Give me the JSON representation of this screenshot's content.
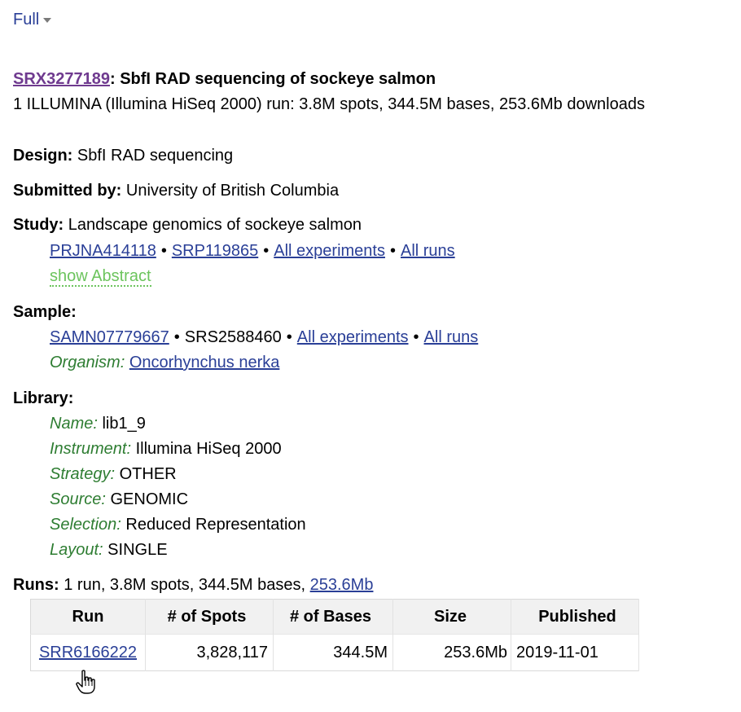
{
  "view_selector": {
    "value": "Full"
  },
  "experiment": {
    "accession": "SRX3277189",
    "title": "SbfI RAD sequencing of sockeye salmon",
    "summary": "1 ILLUMINA (Illumina HiSeq 2000) run: 3.8M spots, 344.5M bases, 253.6Mb downloads"
  },
  "design": {
    "label": "Design:",
    "value": "SbfI RAD sequencing"
  },
  "submitted_by": {
    "label": "Submitted by:",
    "value": "University of British Columbia"
  },
  "study": {
    "label": "Study:",
    "value": "Landscape genomics of sockeye salmon",
    "bioproject": "PRJNA414118",
    "srp": "SRP119865",
    "all_experiments": "All experiments",
    "all_runs": "All runs",
    "show_abstract": "show Abstract",
    "bullet": "•"
  },
  "sample": {
    "label": "Sample:",
    "biosample": "SAMN07779667",
    "srs": "SRS2588460",
    "all_experiments": "All experiments",
    "all_runs": "All runs",
    "organism_label": "Organism:",
    "organism": "Oncorhynchus nerka",
    "bullet": "•"
  },
  "library": {
    "label": "Library:",
    "fields": [
      {
        "label": "Name:",
        "value": "lib1_9"
      },
      {
        "label": "Instrument:",
        "value": "Illumina HiSeq 2000"
      },
      {
        "label": "Strategy:",
        "value": "OTHER"
      },
      {
        "label": "Source:",
        "value": "GENOMIC"
      },
      {
        "label": "Selection:",
        "value": "Reduced Representation"
      },
      {
        "label": "Layout:",
        "value": "SINGLE"
      }
    ]
  },
  "runs": {
    "label": "Runs:",
    "summary": "1 run, 3.8M spots, 344.5M bases,",
    "download_link": "253.6Mb",
    "table": {
      "headers": [
        "Run",
        "# of Spots",
        "# of Bases",
        "Size",
        "Published"
      ],
      "rows": [
        [
          "SRR6166222",
          "3,828,117",
          "344.5M",
          "253.6Mb",
          "2019-11-01"
        ]
      ]
    }
  }
}
